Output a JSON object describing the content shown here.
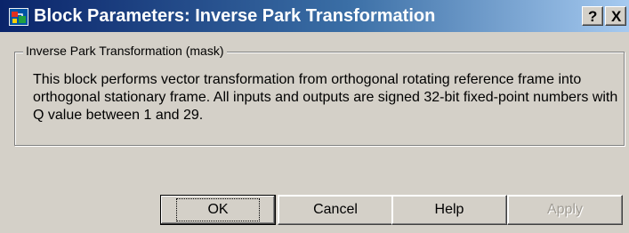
{
  "window": {
    "title": "Block Parameters: Inverse Park Transformation",
    "help_button": "?",
    "close_button": "X"
  },
  "group": {
    "legend": "Inverse Park Transformation (mask)",
    "description": "This block performs vector transformation from orthogonal rotating reference frame into orthogonal stationary frame. All inputs and outputs are signed 32-bit fixed-point numbers with Q value between 1 and 29."
  },
  "buttons": {
    "ok": "OK",
    "cancel": "Cancel",
    "help": "Help",
    "apply": "Apply"
  },
  "colors": {
    "title_gradient_start": "#0a246a",
    "title_gradient_end": "#a6caf0",
    "dialog_background": "#d4d0c8"
  },
  "icons": {
    "app": "simulink-block-icon"
  }
}
